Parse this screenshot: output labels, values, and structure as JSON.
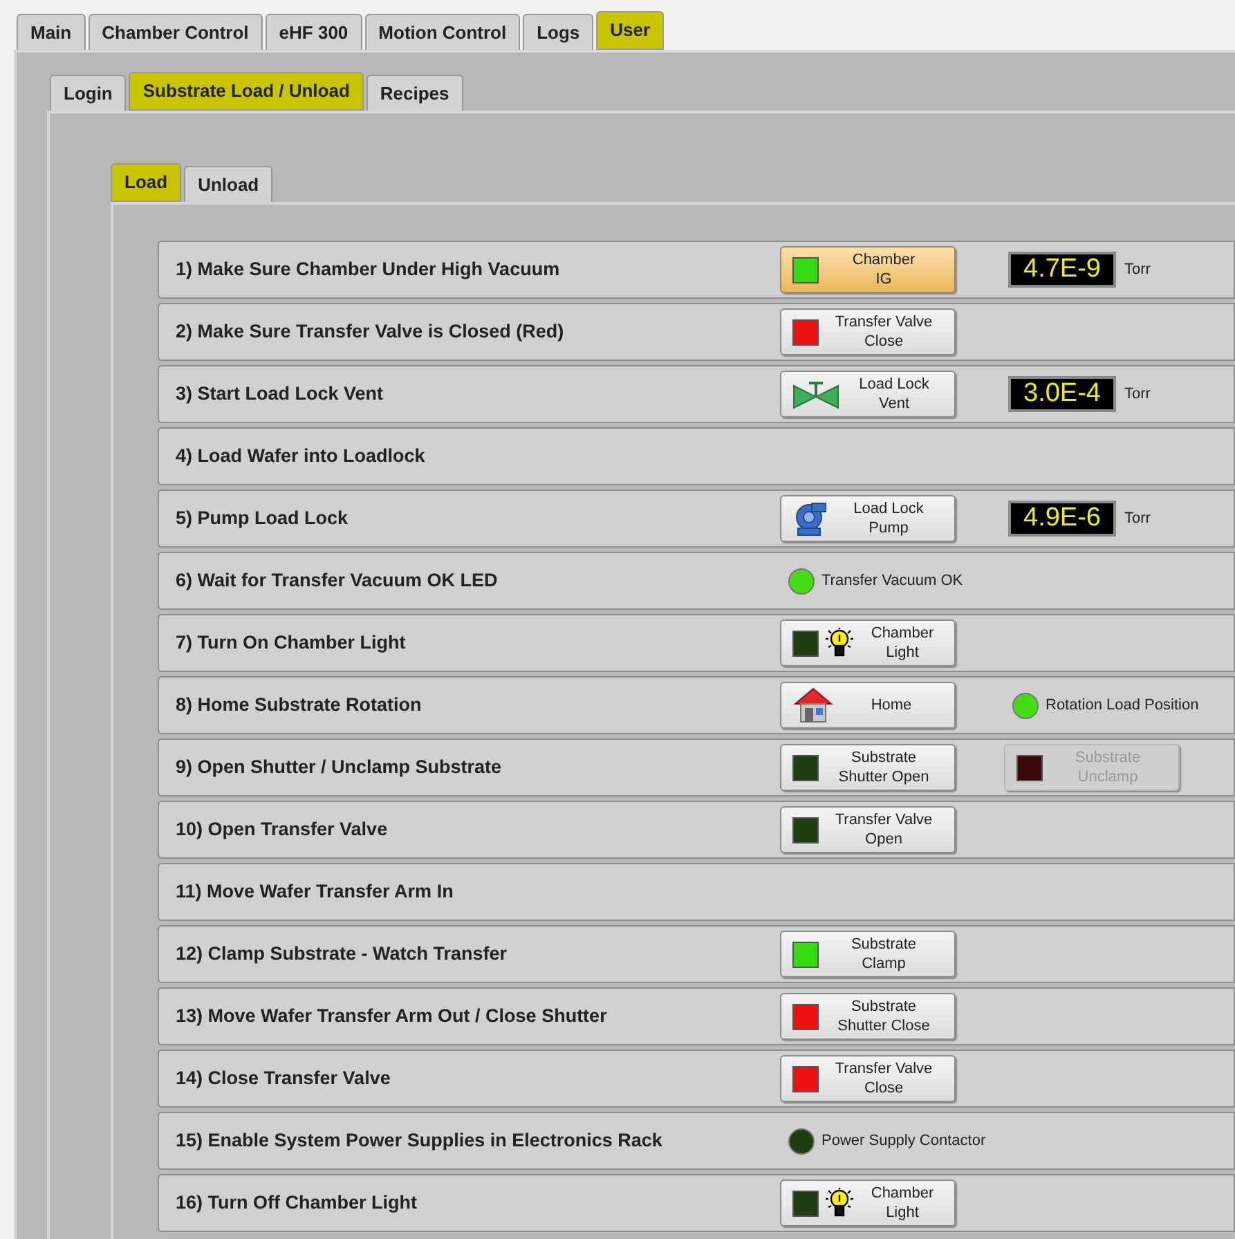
{
  "main_tabs": [
    {
      "label": "Main",
      "selected": false
    },
    {
      "label": "Chamber Control",
      "selected": false
    },
    {
      "label": "eHF 300",
      "selected": false
    },
    {
      "label": "Motion Control",
      "selected": false
    },
    {
      "label": "Logs",
      "selected": false
    },
    {
      "label": "User",
      "selected": true
    }
  ],
  "user_tabs": [
    {
      "label": "Login",
      "selected": false
    },
    {
      "label": "Substrate Load / Unload",
      "selected": true
    },
    {
      "label": "Recipes",
      "selected": false
    }
  ],
  "load_tabs": [
    {
      "label": "Load",
      "selected": true
    },
    {
      "label": "Unload",
      "selected": false
    }
  ],
  "steps": [
    {
      "label": "1) Make Sure Chamber Under High Vacuum",
      "controls": [
        {
          "kind": "led_button",
          "color": "#33dd11",
          "label": "Chamber\nIG",
          "highlighted": true
        },
        {
          "kind": "readout",
          "value": "4.7E-9",
          "unit": "Torr"
        }
      ]
    },
    {
      "label": "2) Make Sure Transfer Valve is Closed (Red)",
      "controls": [
        {
          "kind": "led_button",
          "color": "#ee1111",
          "label": "Transfer Valve\nClose"
        }
      ]
    },
    {
      "label": "3) Start Load Lock Vent",
      "controls": [
        {
          "kind": "valve_button",
          "label": "Load Lock\nVent"
        },
        {
          "kind": "readout",
          "value": "3.0E-4",
          "unit": "Torr"
        }
      ]
    },
    {
      "label": "4) Load Wafer into Loadlock"
    },
    {
      "label": "5) Pump Load Lock",
      "controls": [
        {
          "kind": "pump_button",
          "label": "Load Lock\nPump"
        },
        {
          "kind": "readout",
          "value": "4.9E-6",
          "unit": "Torr"
        }
      ]
    },
    {
      "label": "6) Wait for Transfer Vacuum OK LED",
      "controls": [
        {
          "kind": "indicator",
          "color": "#44dd11",
          "label": "Transfer Vacuum OK"
        }
      ]
    },
    {
      "label": "7) Turn On Chamber Light",
      "controls": [
        {
          "kind": "light_button",
          "color": "#1e3d10",
          "label": "Chamber\nLight"
        }
      ]
    },
    {
      "label": "8) Home Substrate Rotation",
      "controls": [
        {
          "kind": "home_button",
          "label": "Home"
        },
        {
          "kind": "indicator",
          "color": "#44dd11",
          "label": "Rotation Load Position"
        }
      ]
    },
    {
      "label": "9) Open Shutter / Unclamp Substrate",
      "controls": [
        {
          "kind": "led_button",
          "color": "#1e3d10",
          "label": "Substrate\nShutter Open"
        },
        {
          "kind": "led_button",
          "color": "#3a0a0a",
          "label": "Substrate\nUnclamp",
          "disabled": true
        }
      ]
    },
    {
      "label": "10) Open Transfer Valve",
      "controls": [
        {
          "kind": "led_button",
          "color": "#1e3d10",
          "label": "Transfer Valve\nOpen"
        }
      ]
    },
    {
      "label": "11) Move Wafer Transfer Arm In"
    },
    {
      "label": "12) Clamp Substrate - Watch Transfer",
      "controls": [
        {
          "kind": "led_button",
          "color": "#33dd11",
          "label": "Substrate\nClamp"
        }
      ]
    },
    {
      "label": "13) Move Wafer Transfer Arm Out / Close Shutter",
      "controls": [
        {
          "kind": "led_button",
          "color": "#ee1111",
          "label": "Substrate\nShutter Close"
        }
      ]
    },
    {
      "label": "14) Close Transfer Valve",
      "controls": [
        {
          "kind": "led_button",
          "color": "#ee1111",
          "label": "Transfer Valve\nClose"
        }
      ]
    },
    {
      "label": "15) Enable System Power Supplies in Electronics Rack",
      "controls": [
        {
          "kind": "indicator",
          "color": "#1e3d10",
          "label": "Power Supply Contactor"
        }
      ]
    },
    {
      "label": "16) Turn Off Chamber Light",
      "controls": [
        {
          "kind": "light_button",
          "color": "#1e3d10",
          "label": "Chamber\nLight"
        }
      ]
    }
  ]
}
